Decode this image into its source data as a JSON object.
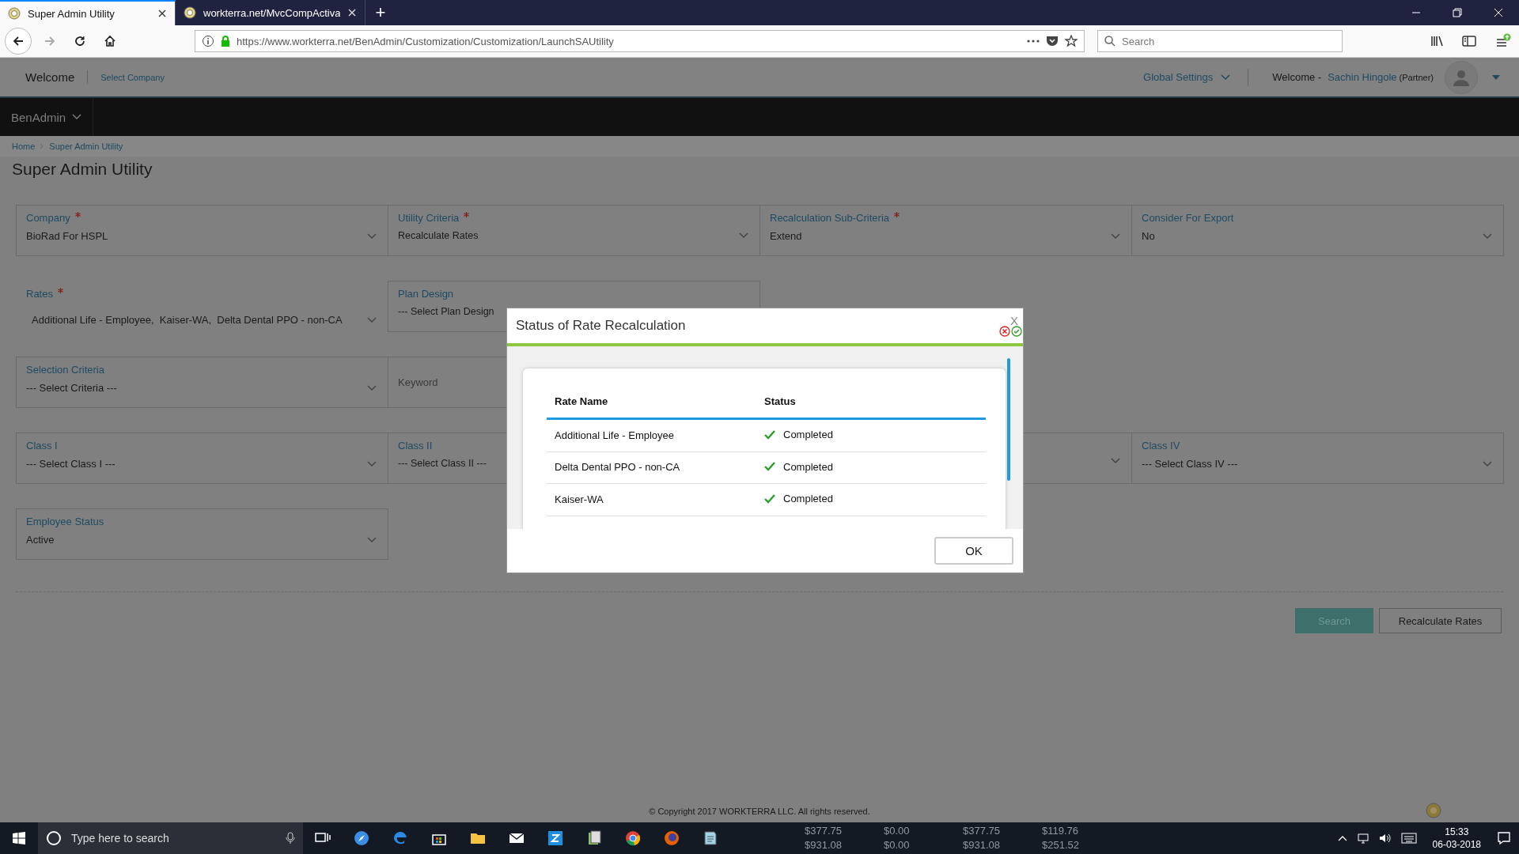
{
  "browser": {
    "tabs": [
      {
        "title": "Super Admin Utility",
        "selected": true
      },
      {
        "title": "workterra.net/MvcCompActiva",
        "selected": false
      }
    ],
    "new_tab": "+",
    "url": "https://www.workterra.net/BenAdmin/Customization/Customization/LaunchSAUtility",
    "search": {
      "placeholder": "Search"
    }
  },
  "header": {
    "welcome": "Welcome",
    "select_company": "Select Company",
    "global_settings": "Global Settings",
    "user_greeting": "Welcome -",
    "user_name": "Sachin Hingole",
    "user_role": "(Partner)"
  },
  "nav": {
    "menu": "BenAdmin"
  },
  "breadcrumb": [
    "Home",
    "Super Admin Utility"
  ],
  "page_title": "Super Admin Utility",
  "form": {
    "rows": [
      [
        {
          "kind": "select",
          "label": "Company",
          "required": true,
          "value": "BioRad For HSPL"
        },
        {
          "kind": "select",
          "label": "Utility Criteria",
          "required": true,
          "value": "Recalculate Rates"
        },
        {
          "kind": "select",
          "label": "Recalculation Sub-Criteria",
          "required": true,
          "value": "Extend"
        },
        {
          "kind": "select",
          "label": "Consider For Export",
          "required": false,
          "value": "No"
        }
      ],
      [
        {
          "kind": "multiselect",
          "label": "Rates",
          "required": true,
          "value": "Additional Life - Employee,  Kaiser-WA,  Delta Dental PPO - non-CA"
        },
        {
          "kind": "select",
          "label": "Plan Design",
          "required": false,
          "value": "--- Select Plan Design"
        }
      ],
      [
        {
          "kind": "select",
          "label": "Selection Criteria",
          "required": false,
          "value": "--- Select Criteria ---"
        },
        {
          "kind": "input",
          "placeholder": "Keyword"
        }
      ],
      [
        {
          "kind": "select",
          "label": "Class I",
          "required": false,
          "value": "--- Select Class I ---"
        },
        {
          "kind": "select",
          "label": "Class II",
          "required": false,
          "value": "--- Select Class II ---"
        },
        {
          "kind": "select"
        },
        {
          "kind": "select",
          "label": "Class IV",
          "required": false,
          "value": "--- Select Class IV ---"
        }
      ],
      [
        {
          "kind": "select",
          "label": "Employee Status",
          "required": false,
          "value": "Active"
        }
      ]
    ],
    "buttons": [
      {
        "kind": "primary",
        "label": "Search"
      },
      {
        "kind": "secondary",
        "label": "Recalculate Rates"
      }
    ]
  },
  "footer": "© Copyright 2017 WORKTERRA LLC. All rights reserved.",
  "modal": {
    "title": "Status of Rate Recalculation",
    "close": "X",
    "columns": [
      "Rate Name",
      "Status"
    ],
    "rows": [
      {
        "rate_name": "Additional Life - Employee",
        "status": "Completed"
      },
      {
        "rate_name": "Delta Dental PPO - non-CA",
        "status": "Completed"
      },
      {
        "rate_name": "Kaiser-WA",
        "status": "Completed"
      }
    ],
    "ok": "OK"
  },
  "taskbar": {
    "search_placeholder": "Type here to search",
    "background_values": [
      [
        "$377.75",
        "$0.00",
        "$377.75",
        "$119.76"
      ],
      [
        "$931.08",
        "$0.00",
        "$931.08",
        "$251.52"
      ]
    ],
    "time": "15:33",
    "date": "06-03-2018"
  }
}
